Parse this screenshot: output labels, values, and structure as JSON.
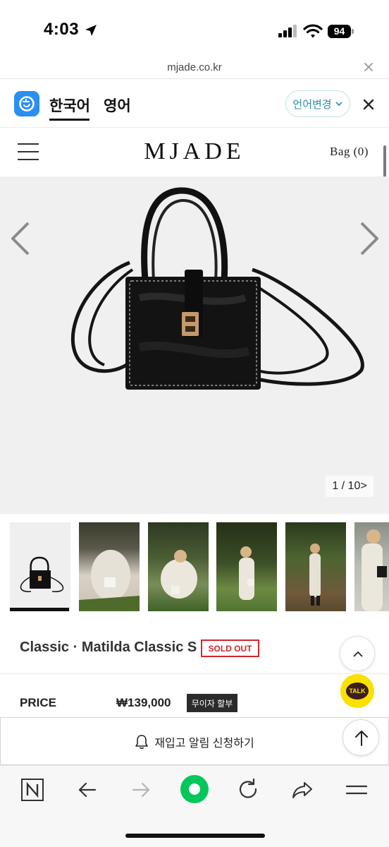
{
  "status": {
    "time": "4:03",
    "battery": "94"
  },
  "browser": {
    "url": "mjade.co.kr"
  },
  "translate": {
    "tab_korean": "한국어",
    "tab_english": "영어",
    "change_language": "언어변경"
  },
  "site": {
    "brand": "MJADE",
    "bag_label": "Bag (0)"
  },
  "gallery": {
    "counter": "1 / 10>"
  },
  "product": {
    "title": "Classic · Matilda Classic S",
    "badge": "SOLD OUT",
    "price_label": "PRICE",
    "price_value": "₩139,000",
    "installment": "무이자 할부"
  },
  "restock": {
    "label": "재입고 알림 신청하기"
  },
  "kakao": {
    "label": "TALK"
  },
  "colors": {
    "accent_teal": "#2b8fa5",
    "soldout_red": "#d0262d",
    "kakao_yellow": "#fae100",
    "naver_green": "#03c75a"
  },
  "icons": [
    "location-arrow-icon",
    "signal-icon",
    "wifi-icon",
    "close-icon",
    "translate-logo-icon",
    "chevron-down-icon",
    "hamburger-icon",
    "chevron-left-icon",
    "chevron-right-icon",
    "chevron-up-icon",
    "bell-icon",
    "arrow-up-icon",
    "naver-n-icon",
    "back-icon",
    "forward-icon",
    "green-dot-icon",
    "reload-icon",
    "share-icon",
    "menu-icon"
  ]
}
